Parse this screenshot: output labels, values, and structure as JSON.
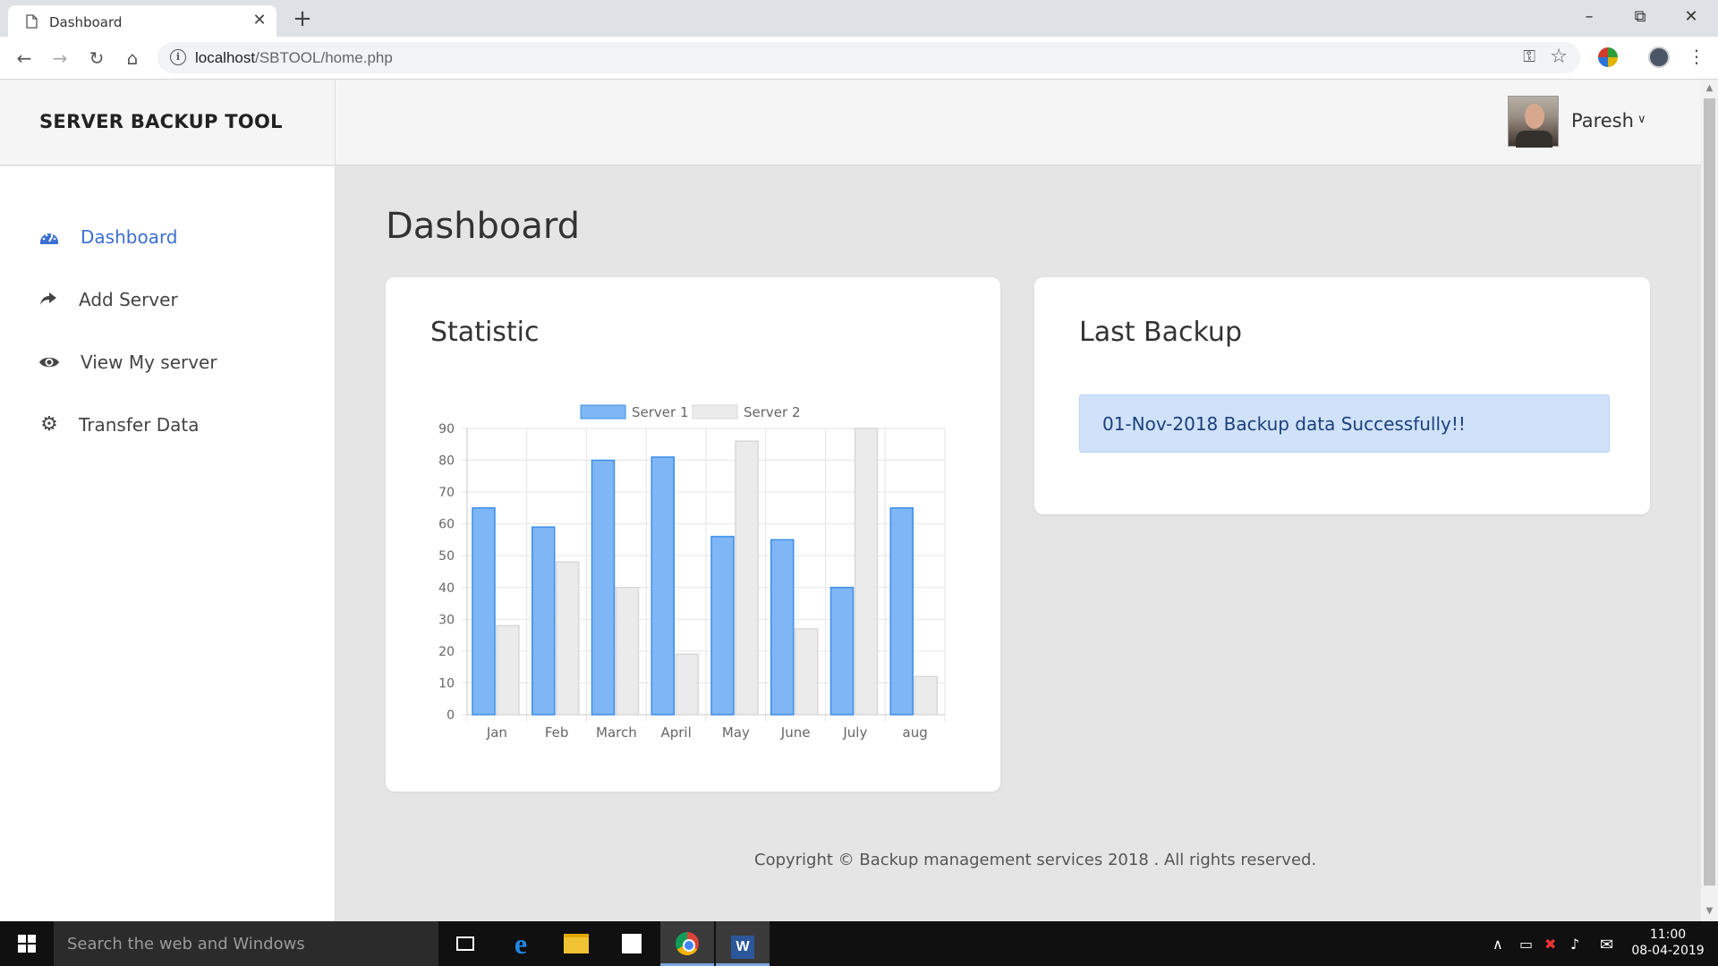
{
  "browser": {
    "tab_title": "Dashboard",
    "tab_close": "✕",
    "new_tab": "+",
    "url": "localhost/SBTOOL/home.php",
    "url_display_host": "localhost",
    "url_display_path": "/SBTOOL/home.php"
  },
  "header": {
    "brand": "SERVER BACKUP TOOL",
    "user_name": "Paresh"
  },
  "sidebar": {
    "items": [
      {
        "label": "Dashboard",
        "icon": "dashboard-gauge-icon",
        "active": true
      },
      {
        "label": "Add Server",
        "icon": "share-arrow-icon",
        "active": false
      },
      {
        "label": "View My server",
        "icon": "eye-icon",
        "active": false
      },
      {
        "label": "Transfer Data",
        "icon": "gear-icon",
        "active": false
      }
    ]
  },
  "main": {
    "page_title": "Dashboard",
    "statistic_card": {
      "title": "Statistic"
    },
    "last_backup_card": {
      "title": "Last Backup",
      "message": "01-Nov-2018 Backup data Successfully!!"
    },
    "footer": "Copyright © Backup management services 2018 . All rights reserved."
  },
  "chart_data": {
    "type": "bar",
    "categories": [
      "Jan",
      "Feb",
      "March",
      "April",
      "May",
      "June",
      "July",
      "aug"
    ],
    "series": [
      {
        "name": "Server 1",
        "values": [
          65,
          59,
          80,
          81,
          56,
          55,
          40,
          65
        ],
        "color": "#7fb6f5",
        "border": "#3d8ee8"
      },
      {
        "name": "Server 2",
        "values": [
          28,
          48,
          40,
          19,
          86,
          27,
          90,
          12
        ],
        "color": "#ebebeb",
        "border": "#d8d8d8"
      }
    ],
    "yticks": [
      0,
      10,
      20,
      30,
      40,
      50,
      60,
      70,
      80,
      90
    ],
    "ylim": [
      0,
      90
    ],
    "grid": true,
    "legend": "top-center"
  },
  "taskbar": {
    "search_placeholder": "Search the web and Windows",
    "time": "11:00",
    "date": "08-04-2019"
  },
  "colors": {
    "accent": "#3b6fd1",
    "alert_bg": "#cfe2fa",
    "alert_text": "#1c3f7a",
    "page_bg": "#e5e5e5"
  }
}
